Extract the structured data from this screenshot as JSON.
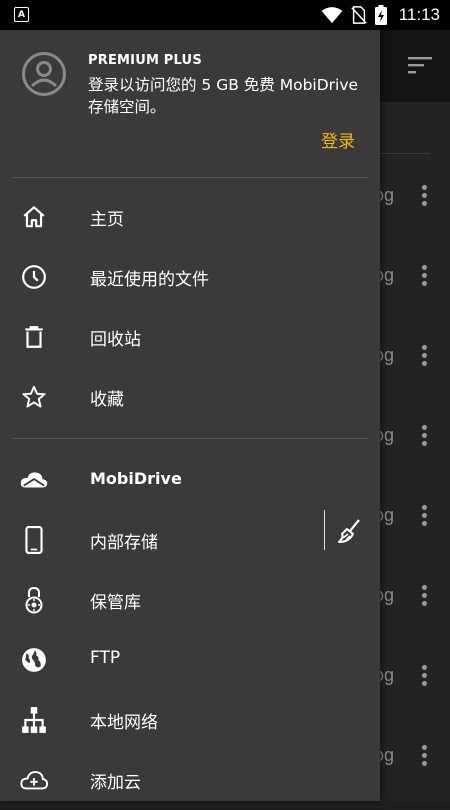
{
  "status_bar": {
    "app_icon_letter": "A",
    "time": "11:13",
    "icons": [
      "wifi-icon",
      "no-sim-icon",
      "battery-charging-icon"
    ]
  },
  "background": {
    "toolbar_icon": "sort-icon",
    "row_text": "og",
    "row_count": 8,
    "row_action_icon": "more-vert-icon"
  },
  "drawer": {
    "header": {
      "avatar_icon": "account-circle-icon",
      "plan_title": "PREMIUM PLUS",
      "login_prompt": "登录以访问您的 5 GB 免费 MobiDrive 存储空间。",
      "login_link": "登录",
      "accent_color": "#f0b90b"
    },
    "section1": [
      {
        "label": "主页",
        "icon": "home-icon"
      },
      {
        "label": "最近使用的文件",
        "icon": "recent-clock-icon"
      },
      {
        "label": "回收站",
        "icon": "trash-icon"
      },
      {
        "label": "收藏",
        "icon": "star-icon"
      }
    ],
    "section2": [
      {
        "label": "MobiDrive",
        "icon": "cloud-icon"
      },
      {
        "label": "内部存储",
        "icon": "phone-icon",
        "action_icon": "broom-clean-icon"
      },
      {
        "label": "保管库",
        "icon": "vault-lock-icon"
      },
      {
        "label": "FTP",
        "icon": "globe-icon"
      },
      {
        "label": "本地网络",
        "icon": "network-icon"
      },
      {
        "label": "添加云",
        "icon": "cloud-add-icon"
      }
    ]
  }
}
